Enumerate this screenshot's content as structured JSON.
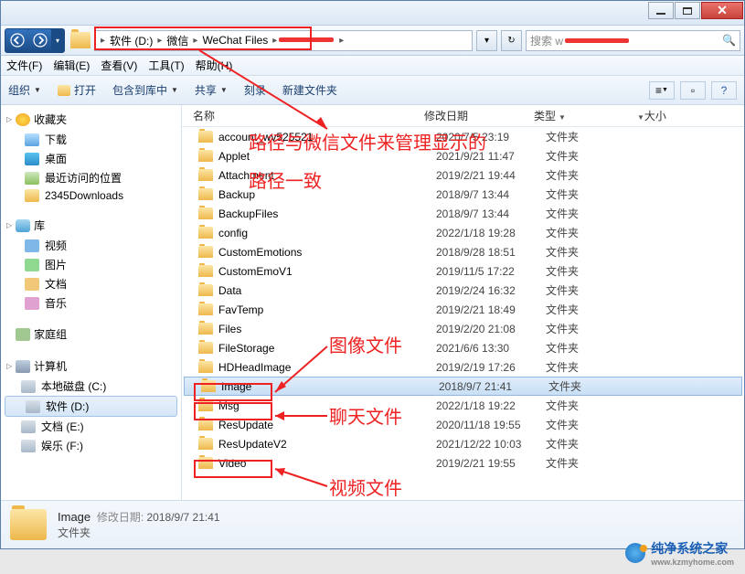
{
  "breadcrumb": {
    "seg1": "软件 (D:)",
    "seg2": "微信",
    "seg3": "WeChat Files"
  },
  "search": {
    "prefix": "搜索 w"
  },
  "menu": {
    "file": "文件(F)",
    "edit": "编辑(E)",
    "view": "查看(V)",
    "tools": "工具(T)",
    "help": "帮助(H)"
  },
  "toolbar": {
    "org": "组织",
    "open": "打开",
    "include": "包含到库中",
    "share": "共享",
    "burn": "刻录",
    "newfolder": "新建文件夹"
  },
  "columns": {
    "name": "名称",
    "date": "修改日期",
    "type": "类型",
    "size": "大小"
  },
  "sidebar": {
    "fav": "收藏夹",
    "dl": "下载",
    "desk": "桌面",
    "recent": "最近访问的位置",
    "dl2345": "2345Downloads",
    "lib": "库",
    "vid": "视频",
    "pic": "图片",
    "doc": "文档",
    "mus": "音乐",
    "home": "家庭组",
    "comp": "计算机",
    "c": "本地磁盘 (C:)",
    "d": "软件 (D:)",
    "e": "文档 (E:)",
    "f": "娱乐 (F:)"
  },
  "typefolder": "文件夹",
  "files": [
    {
      "name": "account_wv525521",
      "date": "2020/7/5 23:19"
    },
    {
      "name": "Applet",
      "date": "2021/9/21 11:47"
    },
    {
      "name": "Attachment",
      "date": "2019/2/21 19:44"
    },
    {
      "name": "Backup",
      "date": "2018/9/7 13:44"
    },
    {
      "name": "BackupFiles",
      "date": "2018/9/7 13:44"
    },
    {
      "name": "config",
      "date": "2022/1/18 19:28"
    },
    {
      "name": "CustomEmotions",
      "date": "2018/9/28 18:51"
    },
    {
      "name": "CustomEmoV1",
      "date": "2019/11/5 17:22"
    },
    {
      "name": "Data",
      "date": "2019/2/24 16:32"
    },
    {
      "name": "FavTemp",
      "date": "2019/2/21 18:49"
    },
    {
      "name": "Files",
      "date": "2019/2/20 21:08"
    },
    {
      "name": "FileStorage",
      "date": "2021/6/6 13:30"
    },
    {
      "name": "HDHeadImage",
      "date": "2019/2/19 17:26"
    },
    {
      "name": "Image",
      "date": "2018/9/7 21:41",
      "sel": true
    },
    {
      "name": "Msg",
      "date": "2022/1/18 19:22"
    },
    {
      "name": "ResUpdate",
      "date": "2020/11/18 19:55"
    },
    {
      "name": "ResUpdateV2",
      "date": "2021/12/22 10:03"
    },
    {
      "name": "Video",
      "date": "2019/2/21 19:55"
    }
  ],
  "details": {
    "name": "Image",
    "date_lbl": "修改日期:",
    "date": "2018/9/7 21:41",
    "type": "文件夹"
  },
  "anno": {
    "path": "路径与微信文件来管理显示的",
    "path2": "路径一致",
    "imglbl": "图像文件",
    "msglbl": "聊天文件",
    "vidlbl": "视频文件"
  },
  "watermark": {
    "title": "纯净系统之家",
    "url": "www.kzmyhome.com"
  }
}
